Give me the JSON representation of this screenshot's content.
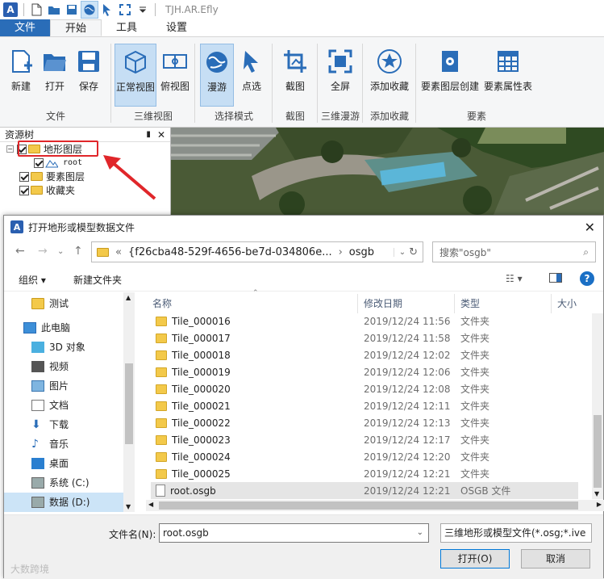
{
  "app": {
    "title": "TJH.AR.Efly",
    "logo": "A"
  },
  "menubar": {
    "file": "文件",
    "tabs": [
      "开始",
      "工具",
      "设置"
    ]
  },
  "ribbon": {
    "buttons": {
      "new": "新建",
      "open": "打开",
      "save": "保存",
      "normal_view": "正常视图",
      "top_view": "俯视图",
      "roam": "漫游",
      "point_select": "点选",
      "screenshot": "截图",
      "fullscreen": "全屏",
      "add_favorite": "添加收藏",
      "layer_create": "要素图层创建",
      "attr_table": "要素属性表"
    },
    "groups": {
      "file": "文件",
      "view3d": "三维视图",
      "select_mode": "选择模式",
      "screenshot": "截图",
      "roam3d": "三维漫游",
      "favorite": "添加收藏",
      "feature": "要素"
    }
  },
  "tree": {
    "title": "资源树",
    "pin": "📌",
    "close": "✕",
    "items": {
      "terrain": "地形图层",
      "root": "root",
      "feature": "要素图层",
      "favorite": "收藏夹"
    }
  },
  "dialog": {
    "title": "打开地形或模型数据文件",
    "close": "✕",
    "path": {
      "prefix": "«",
      "guid": "{f26cba48-529f-4656-be7d-034806e...",
      "sep": "›",
      "folder": "osgb"
    },
    "search_placeholder": "搜索\"osgb\"",
    "toolbar": {
      "organize": "组织 ▾",
      "new_folder": "新建文件夹"
    },
    "nav": {
      "test": "测试",
      "pc": "此电脑",
      "obj3d": "3D 对象",
      "video": "视频",
      "pictures": "图片",
      "docs": "文档",
      "downloads": "下载",
      "music": "音乐",
      "desktop": "桌面",
      "c": "系统 (C:)",
      "d": "数据 (D:)"
    },
    "columns": {
      "name": "名称",
      "date": "修改日期",
      "type": "类型",
      "size": "大小"
    },
    "files": [
      {
        "name": "Tile_000016",
        "date": "2019/12/24 11:56",
        "type": "文件夹"
      },
      {
        "name": "Tile_000017",
        "date": "2019/12/24 11:58",
        "type": "文件夹"
      },
      {
        "name": "Tile_000018",
        "date": "2019/12/24 12:02",
        "type": "文件夹"
      },
      {
        "name": "Tile_000019",
        "date": "2019/12/24 12:06",
        "type": "文件夹"
      },
      {
        "name": "Tile_000020",
        "date": "2019/12/24 12:08",
        "type": "文件夹"
      },
      {
        "name": "Tile_000021",
        "date": "2019/12/24 12:11",
        "type": "文件夹"
      },
      {
        "name": "Tile_000022",
        "date": "2019/12/24 12:13",
        "type": "文件夹"
      },
      {
        "name": "Tile_000023",
        "date": "2019/12/24 12:17",
        "type": "文件夹"
      },
      {
        "name": "Tile_000024",
        "date": "2019/12/24 12:20",
        "type": "文件夹"
      },
      {
        "name": "Tile_000025",
        "date": "2019/12/24 12:21",
        "type": "文件夹"
      },
      {
        "name": "root.osgb",
        "date": "2019/12/24 12:21",
        "type": "OSGB 文件"
      }
    ],
    "filename_label": "文件名(N):",
    "filename_value": "root.osgb",
    "filetype": "三维地形或模型文件(*.osg;*.ive",
    "open_btn": "打开(O)",
    "cancel_btn": "取消"
  },
  "watermark": "大数跨境",
  "colors": {
    "accent": "#2a6db8",
    "selected": "#c6def4",
    "highlight": "#e0262a",
    "folder": "#f3c94a"
  }
}
